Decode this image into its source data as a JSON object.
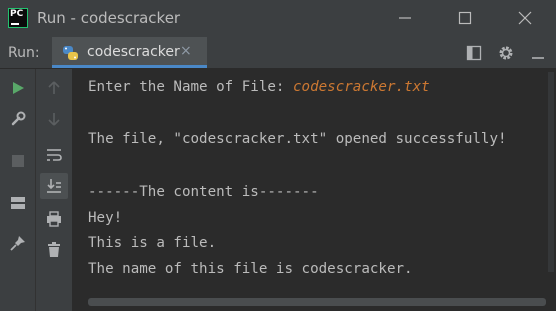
{
  "window": {
    "app_icon_text": "PC",
    "title": "Run - codescracker"
  },
  "toolbar": {
    "run_label": "Run:",
    "tab_label": "codescracker",
    "tab_close": "×"
  },
  "console": {
    "prompt": "Enter the Name of File: ",
    "input_value": "codescracker.txt",
    "lines": [
      "The file, \"codescracker.txt\" opened successfully!",
      "------The content is-------",
      "Hey!",
      "This is a file.",
      "The name of this file is codescracker."
    ]
  },
  "colors": {
    "title_bg": "#3c3f41",
    "console_bg": "#2b2b2b",
    "text": "#bbbbbb",
    "input_text": "#cc7832",
    "accent": "#4a88c7",
    "run_green": "#59a869"
  },
  "icons": {
    "left_gutter": [
      "run-icon",
      "wrench-icon",
      "stop-icon",
      "layout-icon",
      "pin-icon"
    ],
    "second_gutter": [
      "up-arrow-icon",
      "down-arrow-icon",
      "soft-wrap-icon",
      "scroll-to-end-icon",
      "print-icon",
      "trash-icon"
    ],
    "top_right": [
      "restore-layout-icon",
      "gear-icon",
      "minimize-panel-icon"
    ]
  }
}
